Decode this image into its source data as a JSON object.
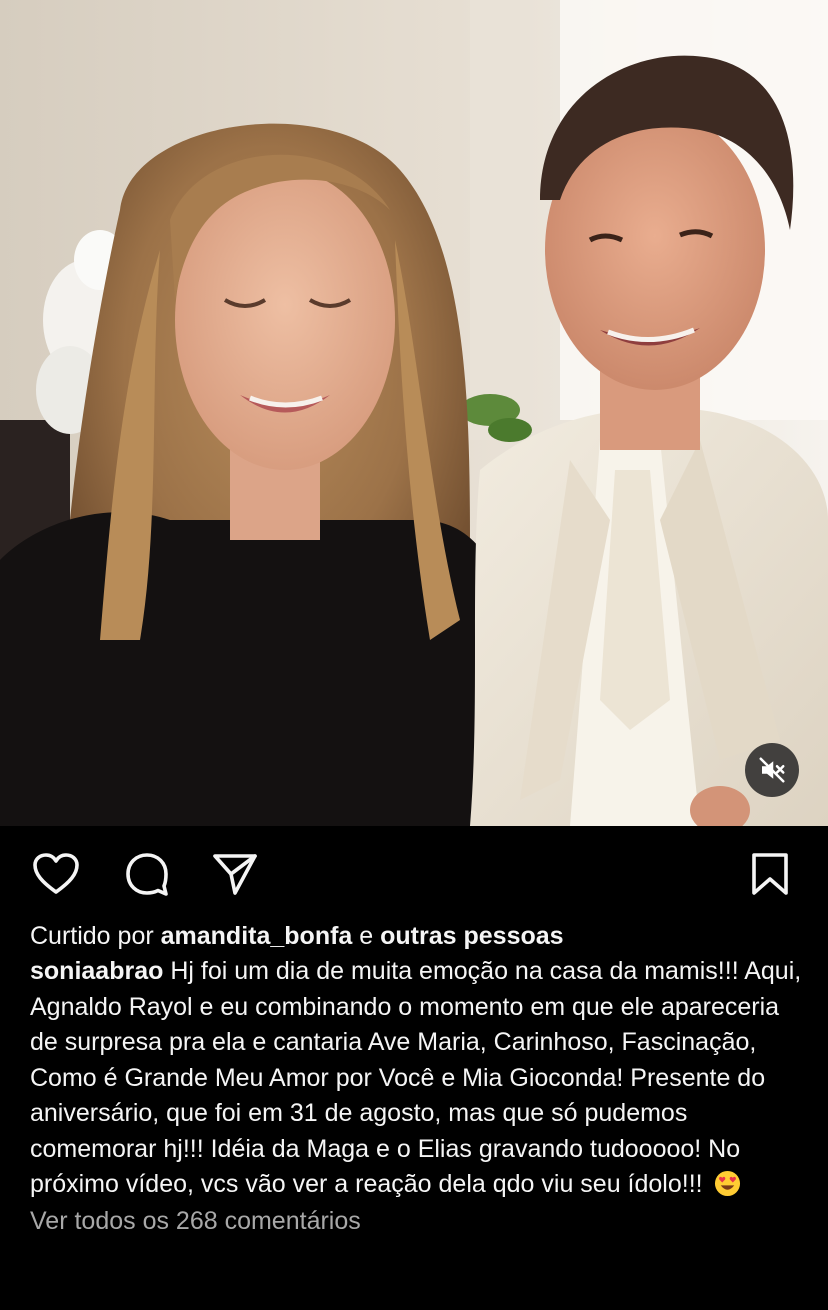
{
  "post": {
    "likes": {
      "prefix": "Curtido por",
      "user": "amandita_bonfa",
      "conjunction": "e",
      "others": "outras pessoas"
    },
    "caption": {
      "username": "soniaabrao",
      "text": "Hj foi um dia de muita emoção na casa da mamis!!! Aqui, Agnaldo Rayol e eu combinando o momento em que ele apareceria de surpresa pra ela e cantaria Ave Maria, Carinhoso, Fascinação, Como é Grande Meu Amor por Você e Mia Gioconda! Presente do aniversário, que foi em 31 de agosto, mas que só pudemos comemorar hj!!! Idéia da Maga e o Elias gravando tudooooo! No próximo vídeo, vcs vão ver a reação dela qdo viu seu ídolo!!!",
      "emoji": "heart-eyes-emoji"
    },
    "view_comments": "Ver todos os 268 comentários",
    "icons": {
      "like": "heart-icon",
      "comment": "comment-icon",
      "share": "paper-plane-icon",
      "save": "bookmark-icon",
      "mute": "speaker-muted-icon"
    },
    "colors": {
      "background": "#000000",
      "text": "#f5f5f5",
      "secondary_text": "#a8a8a8"
    }
  }
}
